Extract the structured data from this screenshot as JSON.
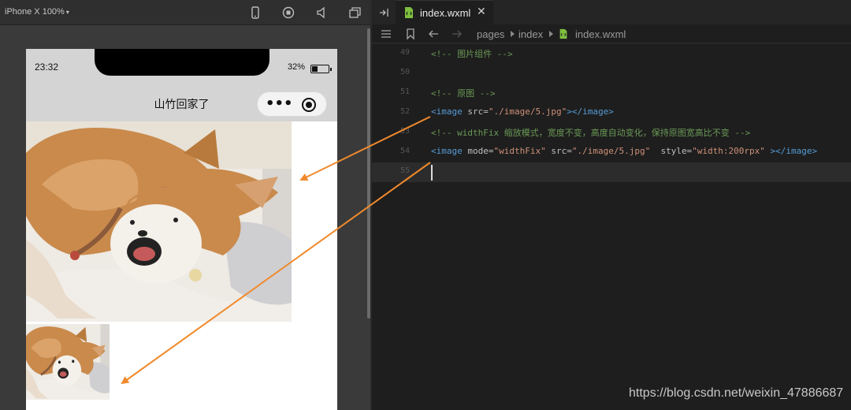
{
  "simulator": {
    "device_label": "iPhone X 100%",
    "caret_glyph": "▾"
  },
  "phone": {
    "status_time": "23:32",
    "battery_text": "32%",
    "nav_title": "山竹回家了",
    "capsule_more_glyph": "•••"
  },
  "editor": {
    "tab_label": "index.wxml",
    "tab_close_glyph": "✕",
    "breadcrumb": [
      "pages",
      "index",
      "index.wxml"
    ],
    "lines": [
      {
        "num": "49",
        "parts": [
          {
            "t": "<!-- 图片组件 -->",
            "c": "cm"
          }
        ]
      },
      {
        "num": "50",
        "parts": []
      },
      {
        "num": "51",
        "parts": [
          {
            "t": "<!-- 原图 -->",
            "c": "cm"
          }
        ]
      },
      {
        "num": "52",
        "parts": [
          {
            "t": "<image",
            "c": "tg"
          },
          {
            "t": " src=",
            "c": "at"
          },
          {
            "t": "\"./image/5.jpg\"",
            "c": "st"
          },
          {
            "t": "></image>",
            "c": "tg"
          }
        ]
      },
      {
        "num": "53",
        "parts": [
          {
            "t": "<!-- widthFix 缩放模式，宽度不变，高度自动变化，保持原图宽高比不变 -->",
            "c": "cm"
          }
        ]
      },
      {
        "num": "54",
        "parts": [
          {
            "t": "<image",
            "c": "tg"
          },
          {
            "t": " mode=",
            "c": "at"
          },
          {
            "t": "\"widthFix\"",
            "c": "st"
          },
          {
            "t": " src=",
            "c": "at"
          },
          {
            "t": "\"./image/5.jpg\"",
            "c": "st"
          },
          {
            "t": "  style=",
            "c": "at"
          },
          {
            "t": "\"width:200rpx\"",
            "c": "st"
          },
          {
            "t": " ></image>",
            "c": "tg"
          }
        ]
      },
      {
        "num": "55",
        "parts": []
      }
    ]
  },
  "watermark": "https://blog.csdn.net/weixin_47886687",
  "colors": {
    "arrow": "#f08a2c",
    "comment": "#6a9955",
    "tag": "#569cd6",
    "string": "#ce9178",
    "file_icon_green": "#7fbf3f"
  },
  "icons": {
    "sim_toolbar": [
      "phone-icon",
      "record-icon",
      "volume-icon",
      "window-icon"
    ],
    "editor": [
      "explorer-toggle-icon",
      "list-icon",
      "bookmark-icon",
      "back-arrow-icon",
      "forward-arrow-icon",
      "wxml-file-icon"
    ]
  }
}
